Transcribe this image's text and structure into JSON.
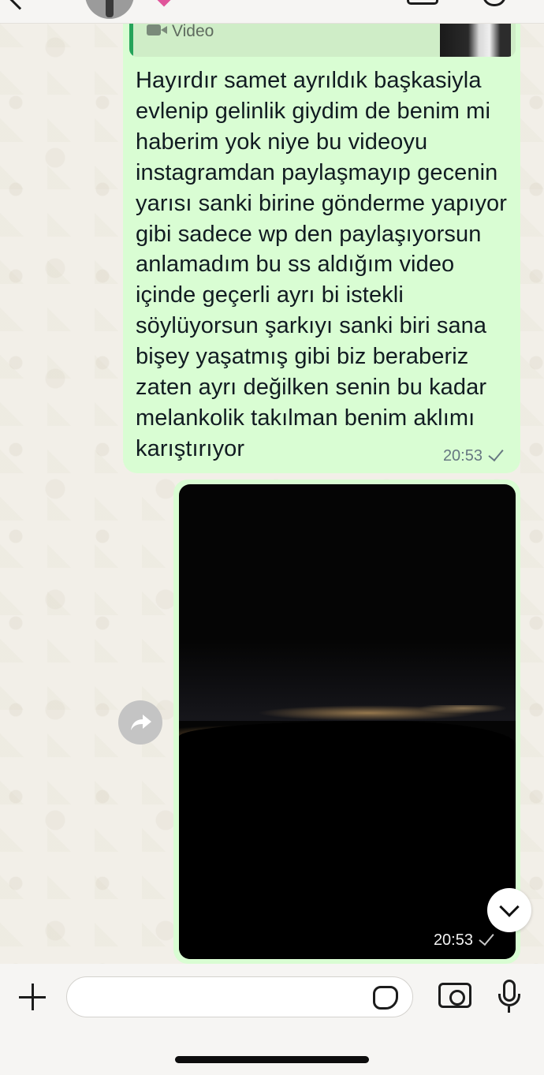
{
  "chat": {
    "quoted_message": {
      "type_label": "Video",
      "icon": "video-camera-icon"
    },
    "outgoing_text": {
      "text": "Hayırdır samet ayrıldık başkasiyla evlenip gelinlik giydim de benim mi haberim yok niye bu videoyu instagramdan paylaşmayıp gecenin yarısı sanki birine gönderme yapıyor gibi sadece wp den paylaşıyorsun anlamadım bu ss aldığım video içinde geçerli ayrı bi istekli söylüyorsun şarkıyı sanki biri sana bişey yaşatmış gibi biz beraberiz zaten ayrı değilken senin bu kadar melankolik takılman benim aklımı karıştırıyor",
      "time": "20:53",
      "status": "single-check-icon"
    },
    "outgoing_video": {
      "time": "20:53",
      "status": "single-check-icon"
    }
  },
  "header": {
    "icons": [
      "back-chevron-icon",
      "avatar",
      "heart-icon",
      "video-call-icon",
      "phone-icon"
    ]
  },
  "composer": {
    "icons": [
      "plus-icon",
      "sticker-icon",
      "camera-icon",
      "mic-icon"
    ]
  },
  "colors": {
    "outgoing_bubble": "#d9fdd3",
    "quote_bar": "#25a35a",
    "wallpaper": "#efeae2"
  }
}
